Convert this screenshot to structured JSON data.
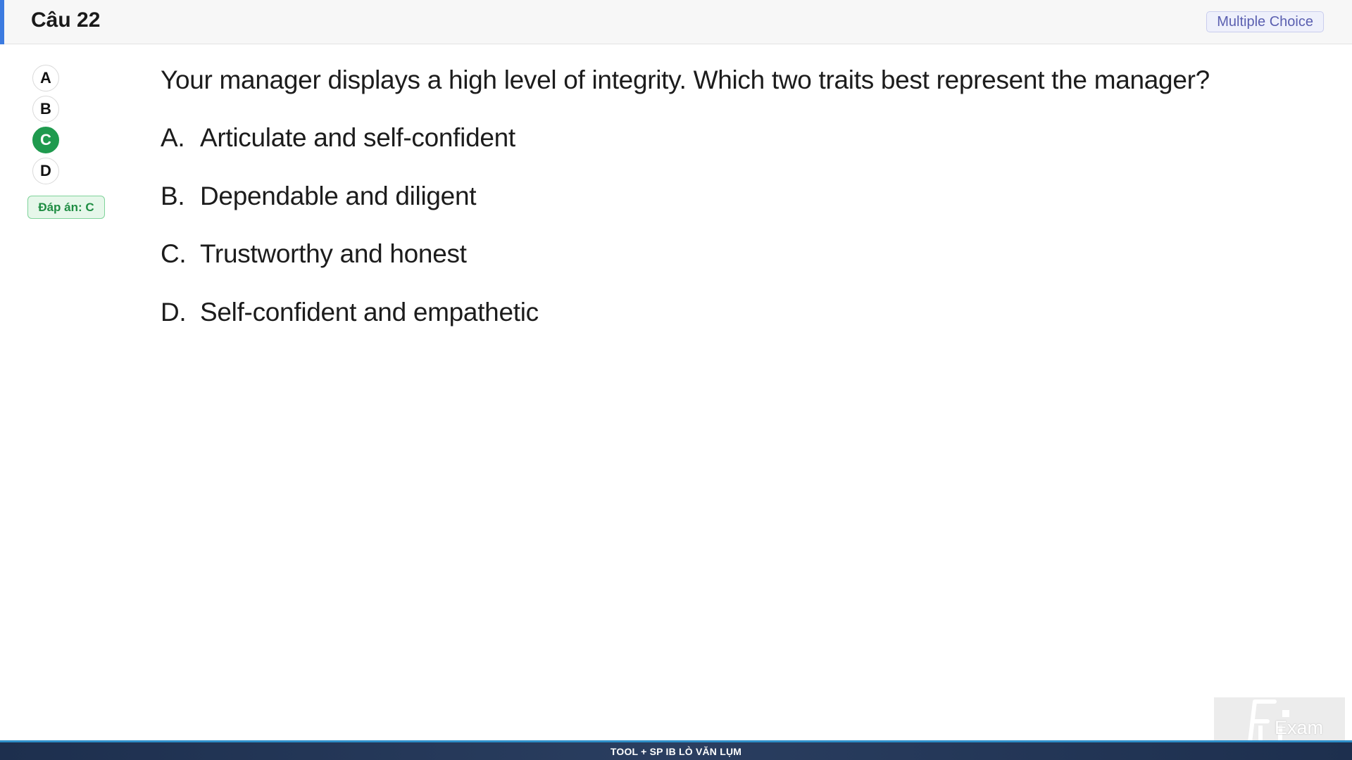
{
  "header": {
    "question_number": "Câu 22",
    "type_badge": "Multiple Choice",
    "accent_color": "#3c7be0"
  },
  "option_selector": {
    "options": [
      "A",
      "B",
      "C",
      "D"
    ],
    "selected": "C",
    "selected_color": "#1f9a4e",
    "answer_label": "Đáp án: C"
  },
  "question": {
    "text": "Your manager displays a high level of integrity. Which two traits best represent the manager?",
    "answers": [
      {
        "letter": "A.",
        "text": "Articulate and self-confident"
      },
      {
        "letter": "B.",
        "text": "Dependable and diligent"
      },
      {
        "letter": "C.",
        "text": "Trustworthy and honest"
      },
      {
        "letter": "D.",
        "text": "Self-confident and empathetic"
      }
    ]
  },
  "footer": {
    "text": "TOOL + SP IB LÒ VĂN LỤM"
  },
  "logo": {
    "text": "Exam",
    "icon": "fu-exam-logo-icon"
  }
}
